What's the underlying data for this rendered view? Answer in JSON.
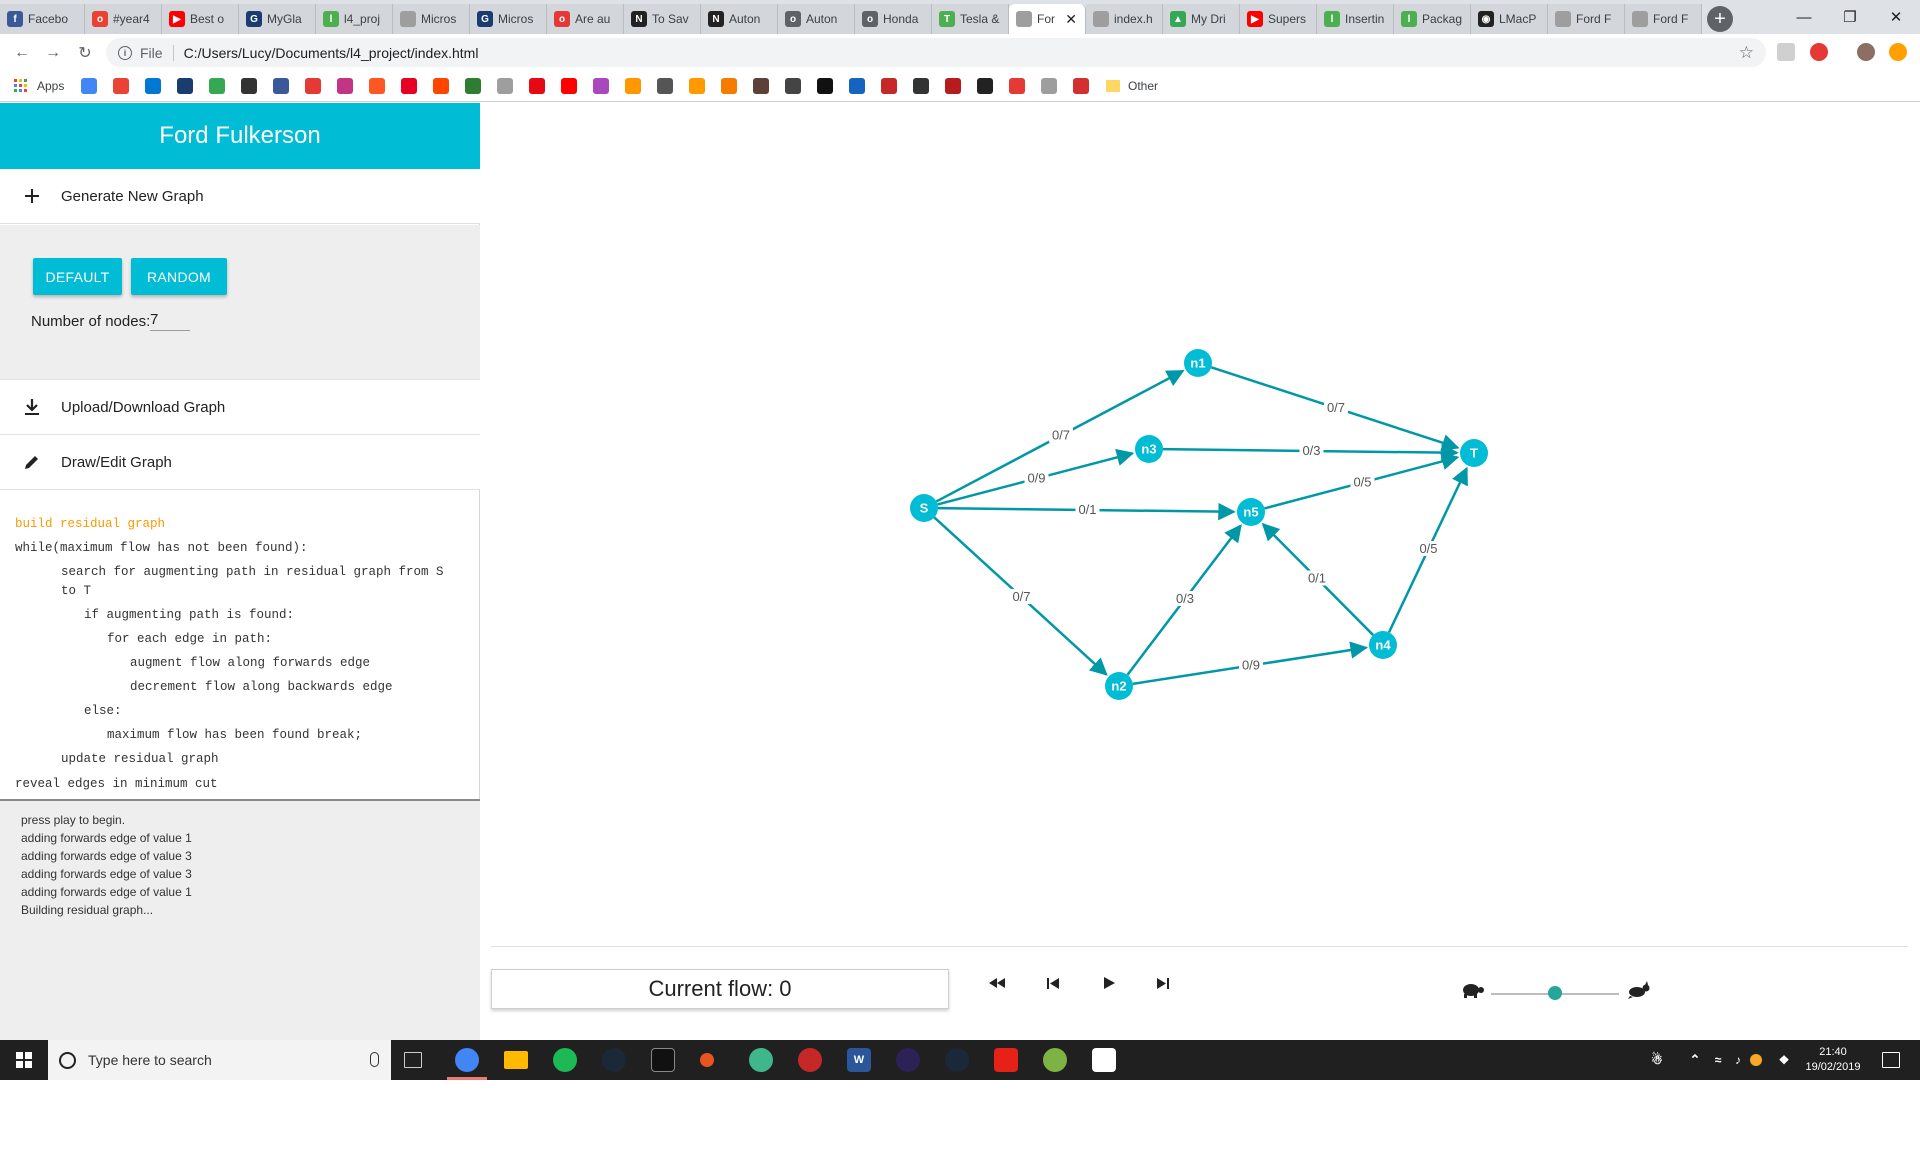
{
  "browser": {
    "tabs": [
      {
        "label": "Facebo",
        "color": "#3b5998",
        "glyph": "f"
      },
      {
        "label": "#year4",
        "color": "#e94235",
        "glyph": "o"
      },
      {
        "label": "Best o",
        "color": "#ff0000",
        "glyph": "▶"
      },
      {
        "label": "MyGla",
        "color": "#1a3c6e",
        "glyph": "G"
      },
      {
        "label": "l4_proj",
        "color": "#4caf50",
        "glyph": "l"
      },
      {
        "label": "Micros",
        "color": "#9e9e9e",
        "glyph": ""
      },
      {
        "label": "Micros",
        "color": "#1a3c6e",
        "glyph": "G"
      },
      {
        "label": "Are au",
        "color": "#e53935",
        "glyph": "o"
      },
      {
        "label": "To Sav",
        "color": "#222222",
        "glyph": "N"
      },
      {
        "label": "Auton",
        "color": "#222222",
        "glyph": "N"
      },
      {
        "label": "Auton",
        "color": "#5f6368",
        "glyph": "o"
      },
      {
        "label": "Honda",
        "color": "#5f6368",
        "glyph": "o"
      },
      {
        "label": "Tesla &",
        "color": "#4caf50",
        "glyph": "T"
      },
      {
        "label": "For",
        "color": "#9e9e9e",
        "glyph": ""
      },
      {
        "label": "index.h",
        "color": "#9e9e9e",
        "glyph": ""
      },
      {
        "label": "My Dri",
        "color": "#34a853",
        "glyph": "▲"
      },
      {
        "label": "Supers",
        "color": "#ff0000",
        "glyph": "▶"
      },
      {
        "label": "Insertin",
        "color": "#4caf50",
        "glyph": "l"
      },
      {
        "label": "Packag",
        "color": "#4caf50",
        "glyph": "l"
      },
      {
        "label": "LMacP",
        "color": "#222222",
        "glyph": "◉"
      },
      {
        "label": "Ford F",
        "color": "#9e9e9e",
        "glyph": ""
      },
      {
        "label": "Ford F",
        "color": "#9e9e9e",
        "glyph": ""
      }
    ],
    "url_scheme": "File",
    "url": "C:/Users/Lucy/Documents/l4_project/index.html",
    "bookmarks": {
      "apps_label": "Apps",
      "other_label": "Other"
    }
  },
  "sidebar": {
    "title": "Ford Fulkerson",
    "generate_label": "Generate New Graph",
    "default_button": "DEFAULT",
    "random_button": "RANDOM",
    "nodes_label": "Number of nodes:",
    "nodes_value": "7",
    "upload_label": "Upload/Download Graph",
    "draw_label": "Draw/Edit Graph"
  },
  "pseudocode": [
    {
      "text": "build residual graph",
      "indent": 0,
      "highlight": true
    },
    {
      "text": "while(maximum flow has not been found):",
      "indent": 0,
      "highlight": false
    },
    {
      "text": "search for augmenting path in residual graph from S",
      "indent": 1,
      "highlight": false
    },
    {
      "text": "to T",
      "indent": 1,
      "highlight": false
    },
    {
      "text": "if augmenting path is found:",
      "indent": 2,
      "highlight": false
    },
    {
      "text": "for each edge in path:",
      "indent": 3,
      "highlight": false
    },
    {
      "text": "augment flow along forwards edge",
      "indent": 4,
      "highlight": false
    },
    {
      "text": "decrement flow along backwards edge",
      "indent": 4,
      "highlight": false
    },
    {
      "text": "else:",
      "indent": 2,
      "highlight": false
    },
    {
      "text": "maximum flow has been found break;",
      "indent": 3,
      "highlight": false
    },
    {
      "text": "update residual graph",
      "indent": 1,
      "highlight": false
    },
    {
      "text": "reveal edges in minimum cut",
      "indent": 0,
      "highlight": false
    }
  ],
  "log": [
    "press play to begin.",
    "adding forwards edge of value 1",
    "adding forwards edge of value 3",
    "adding forwards edge of value 3",
    "adding forwards edge of value 1",
    "Building residual graph..."
  ],
  "graph": {
    "node_color": "#00bcd4",
    "edge_color": "#0097a7",
    "nodes": [
      {
        "id": "S",
        "label": "S"
      },
      {
        "id": "n1",
        "label": "n1"
      },
      {
        "id": "n2",
        "label": "n2"
      },
      {
        "id": "n3",
        "label": "n3"
      },
      {
        "id": "n4",
        "label": "n4"
      },
      {
        "id": "n5",
        "label": "n5"
      },
      {
        "id": "T",
        "label": "T"
      }
    ],
    "edges": [
      {
        "from": "S",
        "to": "n1",
        "label": "0/7"
      },
      {
        "from": "S",
        "to": "n3",
        "label": "0/9"
      },
      {
        "from": "S",
        "to": "n5",
        "label": "0/1"
      },
      {
        "from": "S",
        "to": "n2",
        "label": "0/7"
      },
      {
        "from": "n1",
        "to": "T",
        "label": "0/7"
      },
      {
        "from": "n3",
        "to": "T",
        "label": "0/3"
      },
      {
        "from": "n5",
        "to": "T",
        "label": "0/5"
      },
      {
        "from": "n2",
        "to": "n5",
        "label": "0/3"
      },
      {
        "from": "n4",
        "to": "n5",
        "label": "0/1"
      },
      {
        "from": "n2",
        "to": "n4",
        "label": "0/9"
      },
      {
        "from": "n4",
        "to": "T",
        "label": "0/5"
      }
    ]
  },
  "controls": {
    "current_flow_label": "Current flow: 0",
    "speed_level": 0.5
  },
  "taskbar": {
    "search_placeholder": "Type here to search",
    "time": "21:40",
    "date": "19/02/2019"
  }
}
